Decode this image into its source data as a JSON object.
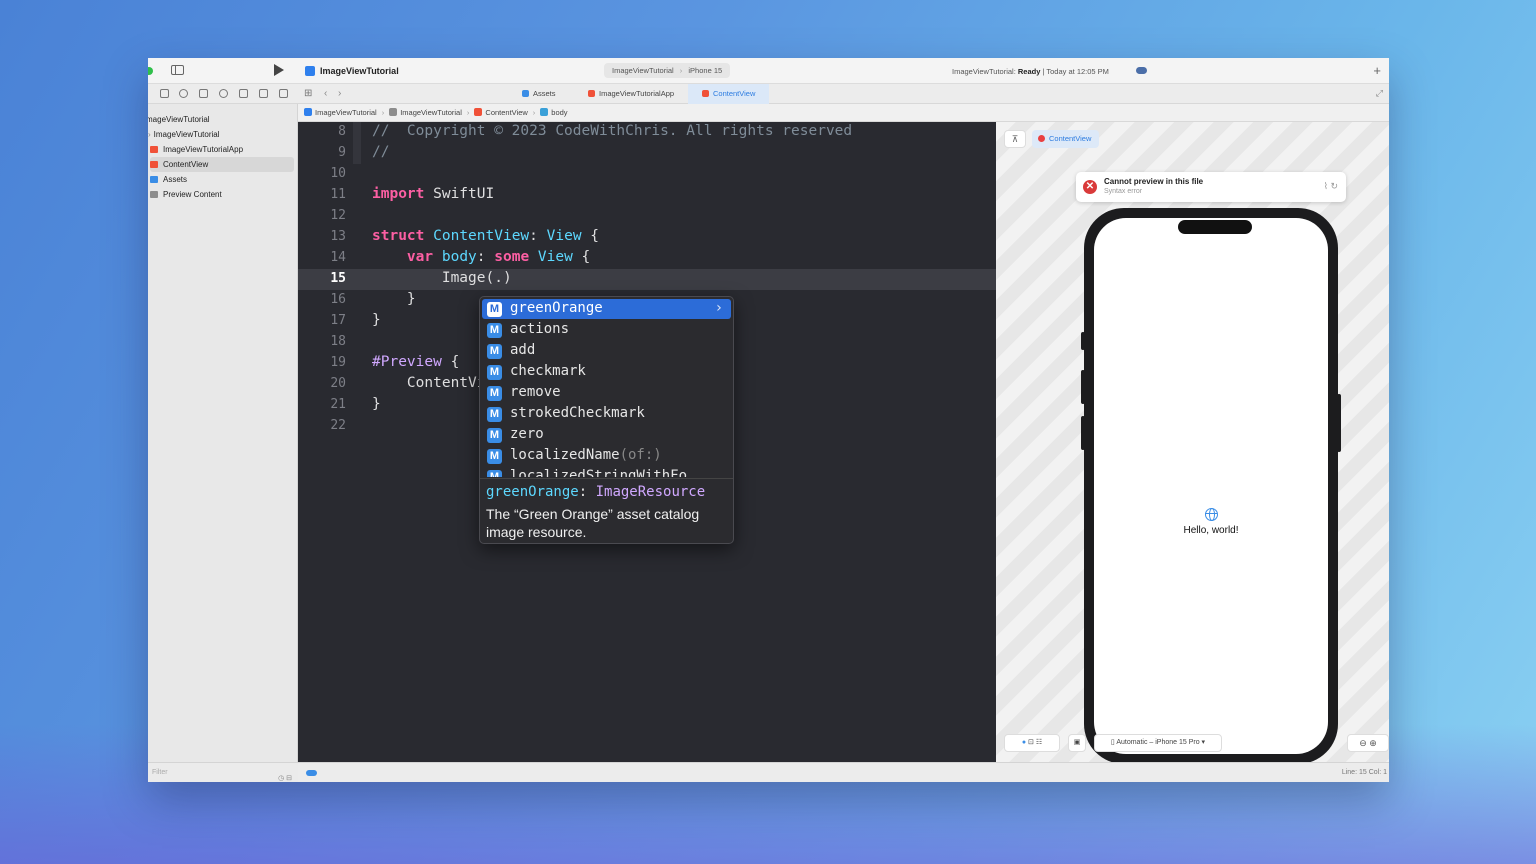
{
  "window": {
    "title": "ImageViewTutorial",
    "scheme": "ImageViewTutorial",
    "destination": "iPhone 15",
    "status_prefix": "ImageViewTutorial:",
    "status_state": "Ready",
    "status_time": "| Today at 12:05 PM"
  },
  "tabs": [
    {
      "label": "Assets",
      "icon_color": "#3a8de6"
    },
    {
      "label": "ImageViewTutorialApp",
      "icon_color": "#f05138"
    },
    {
      "label": "ContentView",
      "icon_color": "#f05138",
      "active": true
    }
  ],
  "jumpbar": [
    "ImageViewTutorial",
    "ImageViewTutorial",
    "ContentView",
    "body"
  ],
  "sidebar": {
    "items": [
      {
        "label": "mageViewTutorial",
        "icon": "project-icon"
      },
      {
        "label": "ImageViewTutorial",
        "icon": "folder-icon"
      },
      {
        "label": "ImageViewTutorialApp",
        "icon": "swift-file-icon"
      },
      {
        "label": "ContentView",
        "icon": "swift-file-icon",
        "selected": true
      },
      {
        "label": "Assets",
        "icon": "asset-catalog-icon"
      },
      {
        "label": "Preview Content",
        "icon": "folder-icon"
      }
    ],
    "filter_placeholder": "Filter"
  },
  "editor": {
    "current_line": 15,
    "lines": [
      {
        "num": "8",
        "text": "//  Copyright © 2023 CodeWithChris. All rights reserved"
      },
      {
        "num": "9",
        "text": "//"
      },
      {
        "num": "10",
        "text": ""
      },
      {
        "num": "11",
        "text": "import SwiftUI"
      },
      {
        "num": "12",
        "text": ""
      },
      {
        "num": "13",
        "text": "struct ContentView: View {"
      },
      {
        "num": "14",
        "text": "    var body: some View {"
      },
      {
        "num": "15",
        "text": "        Image(.)"
      },
      {
        "num": "16",
        "text": "    }"
      },
      {
        "num": "17",
        "text": "}"
      },
      {
        "num": "18",
        "text": ""
      },
      {
        "num": "19",
        "text": "#Preview {"
      },
      {
        "num": "20",
        "text": "    ContentView()"
      },
      {
        "num": "21",
        "text": "}"
      },
      {
        "num": "22",
        "text": ""
      }
    ]
  },
  "autocomplete": {
    "badge": "M",
    "items": [
      {
        "label": "greenOrange",
        "selected": true
      },
      {
        "label": "actions"
      },
      {
        "label": "add"
      },
      {
        "label": "checkmark"
      },
      {
        "label": "remove"
      },
      {
        "label": "strokedCheckmark"
      },
      {
        "label": "zero"
      },
      {
        "label": "localizedName",
        "suffix": "(of:)"
      },
      {
        "label": "localizedStringWithFo"
      }
    ],
    "detail": {
      "name": "greenOrange",
      "colon": ":",
      "type": "ImageResource",
      "description": "The “Green Orange” asset catalog image resource."
    }
  },
  "preview": {
    "chip_label": "ContentView",
    "error_title": "Cannot preview in this file",
    "error_subtitle": "Syntax error",
    "hello_text": "Hello, world!",
    "device_selector": "Automatic – iPhone 15 Pro"
  },
  "statusbar": {
    "line_col": "Line: 15  Col: 1"
  },
  "colors": {
    "keyword": "#fc5fa3",
    "type": "#5dd8ff",
    "comment": "#7f8c98",
    "accent": "#2c6cd8",
    "error": "#d93a3a"
  }
}
